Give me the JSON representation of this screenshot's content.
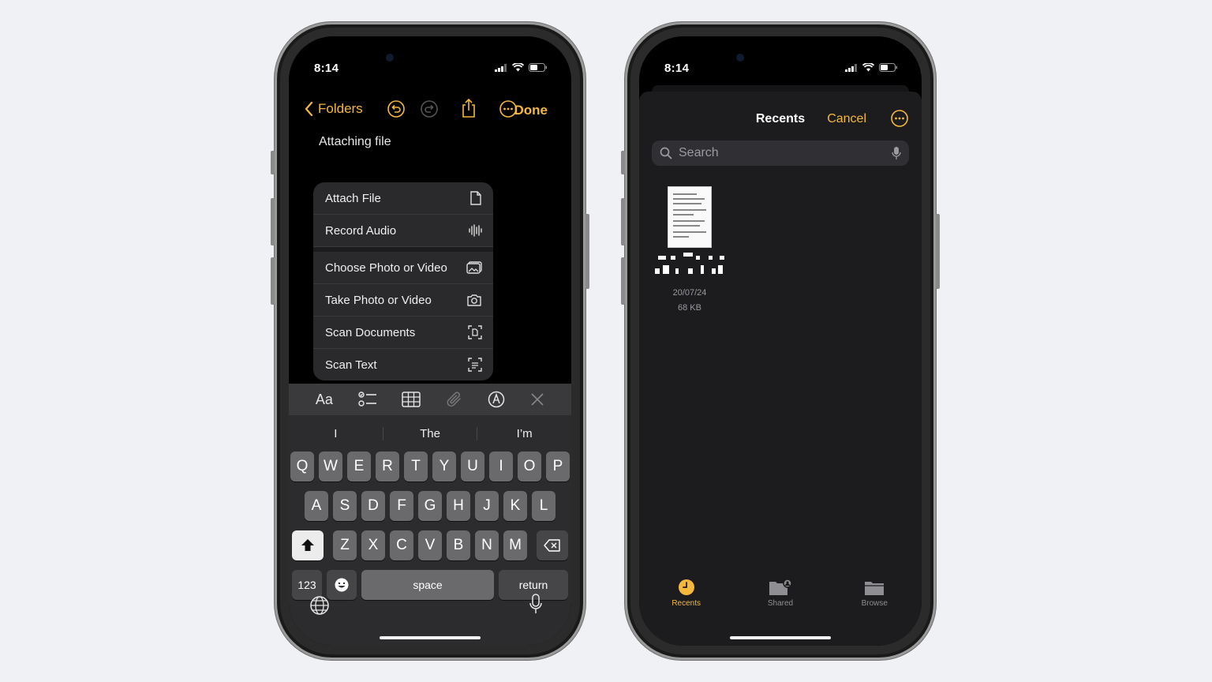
{
  "theme": {
    "accent": "#f5b83d",
    "page_bg": "#f0f1f5"
  },
  "notes_screen": {
    "status": {
      "time": "8:14"
    },
    "nav": {
      "back_label": "Folders",
      "icons": [
        "undo-icon",
        "redo-icon",
        "share-icon",
        "more-icon"
      ],
      "done_label": "Done"
    },
    "note_text": "Attaching file",
    "attach_menu": {
      "group1": [
        {
          "label": "Attach File",
          "icon": "document-icon"
        },
        {
          "label": "Record Audio",
          "icon": "waveform-icon"
        }
      ],
      "group2": [
        {
          "label": "Choose Photo or Video",
          "icon": "photos-icon"
        },
        {
          "label": "Take Photo or Video",
          "icon": "camera-icon"
        },
        {
          "label": "Scan Documents",
          "icon": "scan-document-icon"
        },
        {
          "label": "Scan Text",
          "icon": "scan-text-icon"
        }
      ]
    },
    "format_toolbar": {
      "text_format_label": "Aa"
    },
    "suggestions": [
      "I",
      "The",
      "I’m"
    ],
    "keyboard": {
      "row1": [
        "Q",
        "W",
        "E",
        "R",
        "T",
        "Y",
        "U",
        "I",
        "O",
        "P"
      ],
      "row2": [
        "A",
        "S",
        "D",
        "F",
        "G",
        "H",
        "J",
        "K",
        "L"
      ],
      "row3": [
        "Z",
        "X",
        "C",
        "V",
        "B",
        "N",
        "M"
      ],
      "numbers_label": "123",
      "space_label": "space",
      "return_label": "return"
    }
  },
  "files_screen": {
    "status": {
      "time": "8:14"
    },
    "header": {
      "title": "Recents",
      "cancel_label": "Cancel"
    },
    "search": {
      "placeholder": "Search"
    },
    "file": {
      "date": "20/07/24",
      "size": "68 KB"
    },
    "tabs": [
      {
        "label": "Recents",
        "active": true
      },
      {
        "label": "Shared",
        "active": false
      },
      {
        "label": "Browse",
        "active": false
      }
    ]
  }
}
